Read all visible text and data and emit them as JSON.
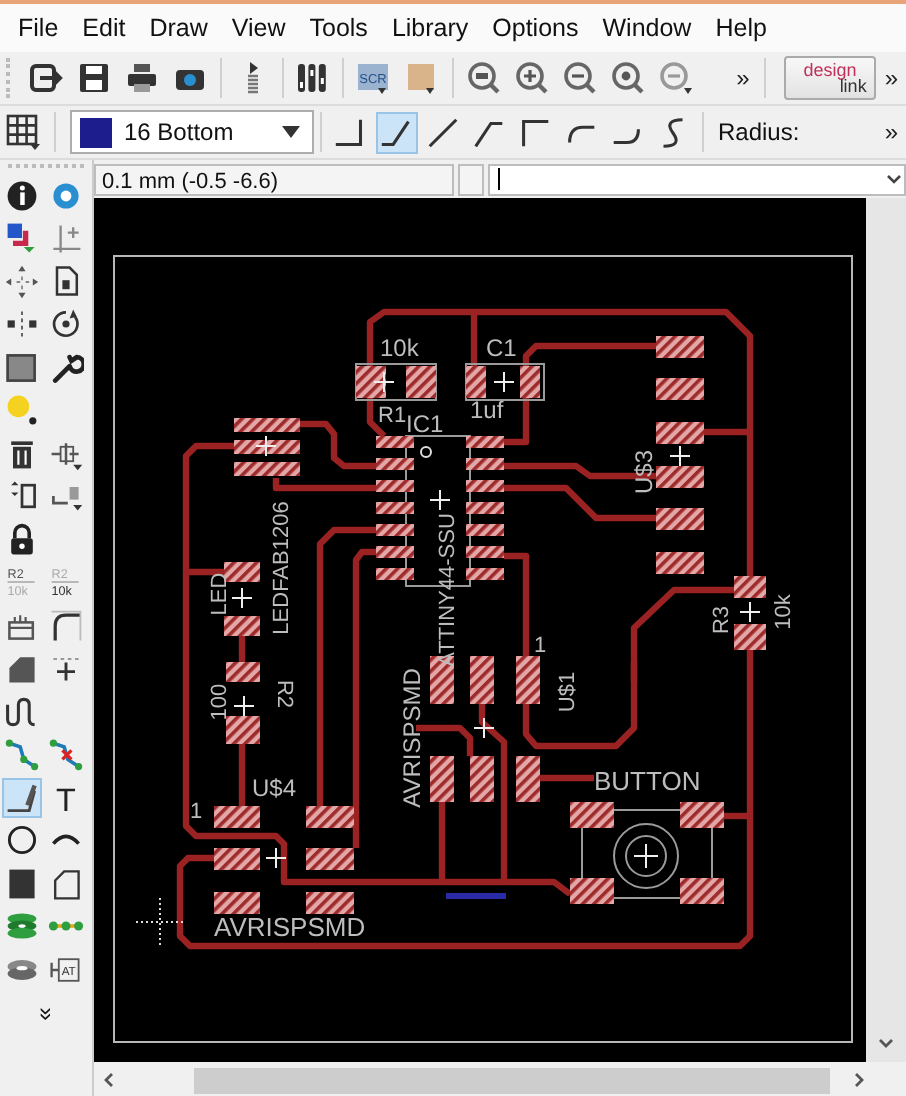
{
  "menu": [
    "File",
    "Edit",
    "Draw",
    "View",
    "Tools",
    "Library",
    "Options",
    "Window",
    "Help"
  ],
  "toolbar": {
    "script_label": "SCR",
    "overflow": "»",
    "design_link": {
      "line1": "design",
      "line2": "link"
    },
    "overflow_end": "»"
  },
  "parameter_bar": {
    "layer": "16 Bottom",
    "bend_styles": [
      {
        "selected": false
      },
      {
        "selected": true
      },
      {
        "selected": false
      },
      {
        "selected": false
      },
      {
        "selected": false
      },
      {
        "selected": false
      },
      {
        "selected": false
      },
      {
        "selected": false
      }
    ],
    "radius_label": "Radius:",
    "overflow": "»"
  },
  "command_bar": {
    "coordinates": "0.1 mm (-0.5 -6.6)"
  },
  "left_toolbar": {
    "rows": [
      [
        {
          "selected": false
        },
        {
          "selected": false
        }
      ],
      [
        {
          "selected": false
        },
        {
          "selected": false
        }
      ],
      [
        {
          "selected": false
        },
        {
          "selected": false
        }
      ],
      [
        {
          "selected": false
        },
        {
          "selected": false
        }
      ],
      [
        {
          "selected": false
        },
        {
          "selected": false
        }
      ],
      [
        {
          "selected": false
        }
      ],
      [
        {
          "selected": false
        },
        {
          "selected": false
        }
      ],
      [
        {
          "selected": false
        },
        {
          "selected": false
        }
      ],
      [
        {
          "selected": false
        }
      ],
      [
        {
          "selected": false,
          "caption": "R2",
          "subcaption": "10k"
        },
        {
          "selected": false,
          "caption": "R2",
          "subcaption": "10k"
        }
      ],
      [
        {
          "selected": false
        },
        {
          "selected": false
        }
      ],
      [
        {
          "selected": false
        },
        {
          "selected": false
        }
      ],
      [
        {
          "selected": false
        }
      ],
      [
        {
          "selected": false
        },
        {
          "selected": false
        }
      ],
      [
        {
          "selected": true
        },
        {
          "selected": false,
          "glyph": "T"
        }
      ],
      [
        {
          "selected": false
        },
        {
          "selected": false
        }
      ],
      [
        {
          "selected": false
        },
        {
          "selected": false
        }
      ],
      [
        {
          "selected": false
        },
        {
          "selected": false
        }
      ],
      [
        {
          "selected": false
        },
        {
          "selected": false,
          "caption": "AT"
        }
      ]
    ],
    "more": "»"
  },
  "board": {
    "labels": [
      {
        "text": "10k"
      },
      {
        "text": "C1"
      },
      {
        "text": "R1"
      },
      {
        "text": "IC1"
      },
      {
        "text": "1uf"
      },
      {
        "text": "U$3"
      },
      {
        "text": "LEDFAB1206"
      },
      {
        "text": "LED"
      },
      {
        "text": "100"
      },
      {
        "text": "R2"
      },
      {
        "text": "ATTINY44-SSU"
      },
      {
        "text": "AVRISPSMD"
      },
      {
        "text": "1"
      },
      {
        "text": "U$1"
      },
      {
        "text": "R3"
      },
      {
        "text": "10k"
      },
      {
        "text": "U$4"
      },
      {
        "text": "1"
      },
      {
        "text": "BUTTON"
      },
      {
        "text": "AVRISPSMD"
      }
    ]
  }
}
